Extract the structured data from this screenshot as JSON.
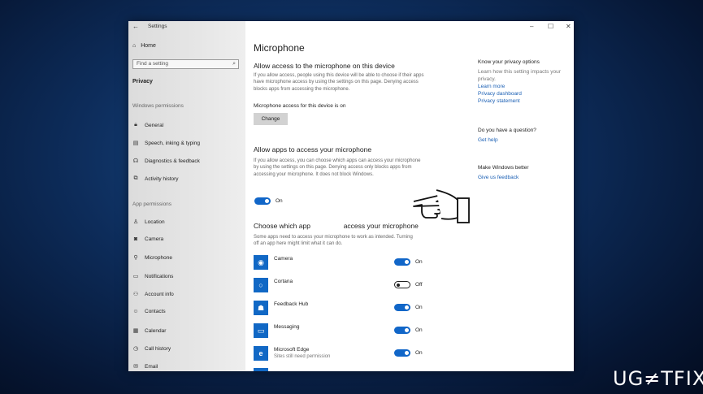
{
  "titlebar": {
    "back_icon": "back-arrow-icon",
    "title": "Settings"
  },
  "sidebar": {
    "home_label": "Home",
    "search_placeholder": "Find a setting",
    "section_privacy": "Privacy",
    "windows_permissions_header": "Windows permissions",
    "windows_items": [
      {
        "label": "General",
        "icon": "lock-icon"
      },
      {
        "label": "Speech, inking & typing",
        "icon": "speech-icon"
      },
      {
        "label": "Diagnostics & feedback",
        "icon": "diagnostics-icon"
      },
      {
        "label": "Activity history",
        "icon": "activity-icon"
      }
    ],
    "app_permissions_header": "App permissions",
    "app_items": [
      {
        "label": "Location",
        "icon": "location-icon"
      },
      {
        "label": "Camera",
        "icon": "camera-icon"
      },
      {
        "label": "Microphone",
        "icon": "microphone-icon"
      },
      {
        "label": "Notifications",
        "icon": "notifications-icon"
      },
      {
        "label": "Account info",
        "icon": "account-icon"
      },
      {
        "label": "Contacts",
        "icon": "contacts-icon"
      },
      {
        "label": "Calendar",
        "icon": "calendar-icon"
      },
      {
        "label": "Call history",
        "icon": "call-history-icon"
      },
      {
        "label": "Email",
        "icon": "email-icon"
      }
    ]
  },
  "main": {
    "title": "Microphone",
    "device_heading": "Allow access to the microphone on this device",
    "device_para": "If you allow access, people using this device will be able to choose if their apps have microphone access by using the settings on this page. Denying access blocks apps from accessing the microphone.",
    "device_status": "Microphone access for this device is on",
    "change_label": "Change",
    "apps_heading": "Allow apps to access your microphone",
    "apps_para": "If you allow access, you can choose which apps can access your microphone by using the settings on this page. Denying access only blocks apps from accessing your microphone. It does not block Windows.",
    "apps_toggle_label": "On",
    "choose_heading_a": "Choose which app",
    "choose_heading_b": "access your microphone",
    "choose_para": "Some apps need to access your microphone to work as intended. Turning off an app here might limit what it can do.",
    "apps": [
      {
        "name": "Camera",
        "sub": "",
        "state": "On",
        "icon": "camera-app-icon"
      },
      {
        "name": "Cortana",
        "sub": "",
        "state": "Off",
        "icon": "cortana-app-icon"
      },
      {
        "name": "Feedback Hub",
        "sub": "",
        "state": "On",
        "icon": "feedback-hub-app-icon"
      },
      {
        "name": "Messaging",
        "sub": "",
        "state": "On",
        "icon": "messaging-app-icon"
      },
      {
        "name": "Microsoft Edge",
        "sub": "Sites still need permission",
        "state": "On",
        "icon": "edge-app-icon"
      }
    ]
  },
  "right": {
    "privacy_heading": "Know your privacy options",
    "privacy_desc": "Learn how this setting impacts your privacy.",
    "links": [
      "Learn more",
      "Privacy dashboard",
      "Privacy statement"
    ],
    "question_heading": "Do you have a question?",
    "help_link": "Get help",
    "better_heading": "Make Windows better",
    "feedback_link": "Give us feedback"
  },
  "window_controls": {
    "minimize": "–",
    "maximize": "☐",
    "close": "✕"
  },
  "watermark": "UG≠TFIX",
  "colors": {
    "accent": "#1166c8",
    "link": "#1a5fb4",
    "sidebar_bg": "#e4e4e4"
  }
}
